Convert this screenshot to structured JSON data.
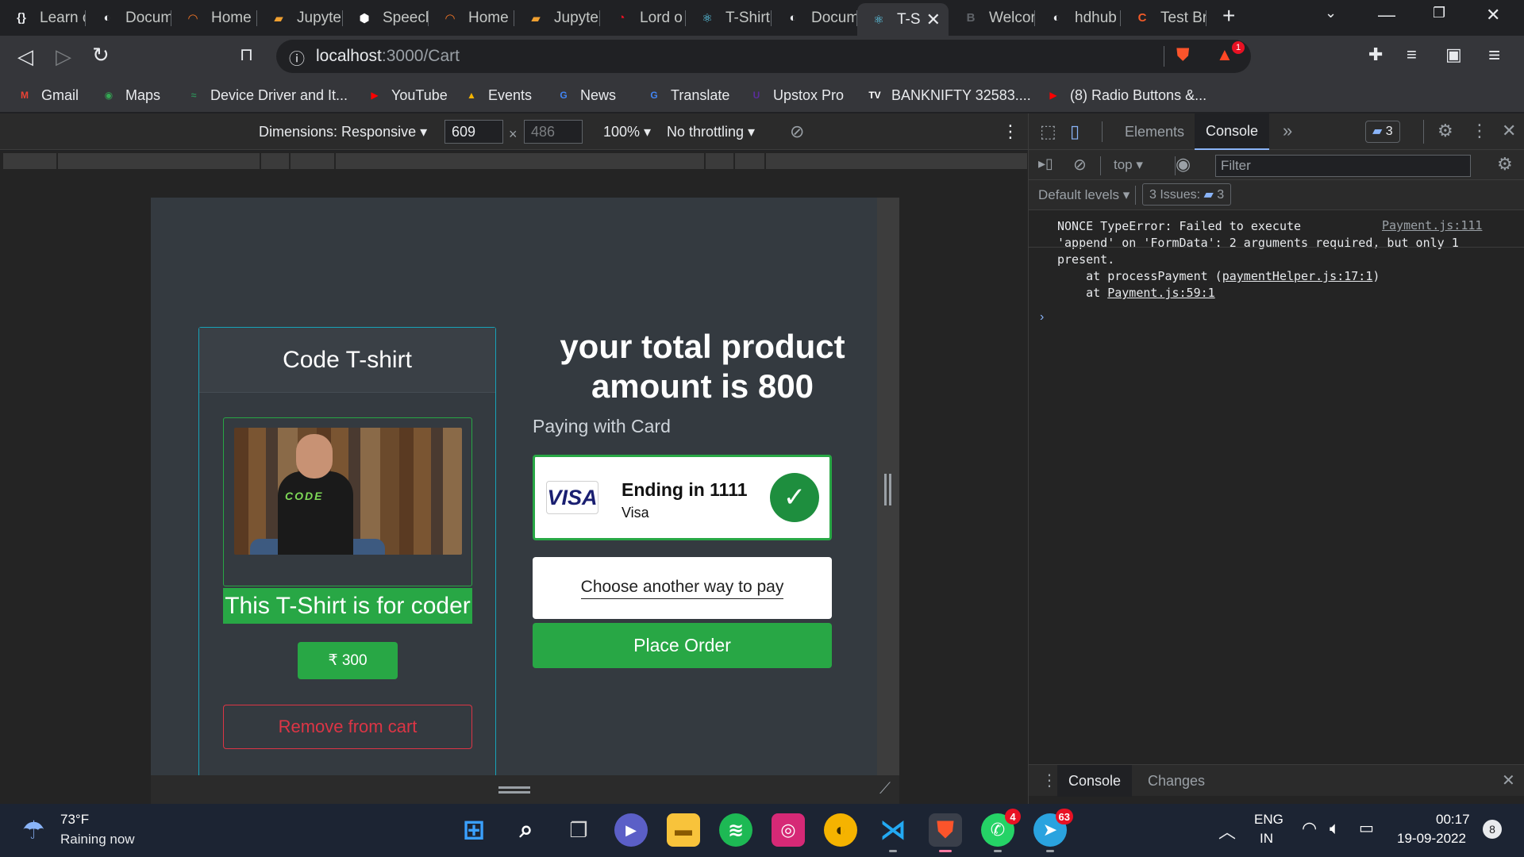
{
  "tabs": [
    {
      "title": "Learn c",
      "icon": "{}",
      "color": "#e8eaed"
    },
    {
      "title": "Docum",
      "icon": "◐",
      "color": "#e8eaed"
    },
    {
      "title": "Home",
      "icon": "◠",
      "color": "#f37626"
    },
    {
      "title": "Jupyte",
      "icon": "▰",
      "color": "#f0a030"
    },
    {
      "title": "Speech",
      "icon": "⬢",
      "color": "#ffffff"
    },
    {
      "title": "Home",
      "icon": "◠",
      "color": "#f37626"
    },
    {
      "title": "Jupyte",
      "icon": "▰",
      "color": "#f0a030"
    },
    {
      "title": "Lord o",
      "icon": "◔",
      "color": "#e81123"
    },
    {
      "title": "T-Shirt",
      "icon": "⚛",
      "color": "#61dafb"
    },
    {
      "title": "Docum",
      "icon": "◐",
      "color": "#e8eaed"
    },
    {
      "title": "T-S",
      "icon": "⚛",
      "color": "#61dafb"
    },
    {
      "title": "Welcor",
      "icon": "B",
      "color": "#5f6368"
    },
    {
      "title": "hdhub",
      "icon": "◐",
      "color": "#e8eaed"
    },
    {
      "title": "Test Br",
      "icon": "C",
      "color": "#f05a28"
    }
  ],
  "address": {
    "host": "localhost",
    "path": ":3000/Cart"
  },
  "brave_badge": "1",
  "bookmarks": [
    {
      "label": "Gmail",
      "icon": "M",
      "color": "#ea4335"
    },
    {
      "label": "Maps",
      "icon": "◉",
      "color": "#34a853"
    },
    {
      "label": "Device Driver and It...",
      "icon": "≈",
      "color": "#2e8b57"
    },
    {
      "label": "YouTube",
      "icon": "▶",
      "color": "#ff0000"
    },
    {
      "label": "Events",
      "icon": "▲",
      "color": "#f4b400"
    },
    {
      "label": "News",
      "icon": "G",
      "color": "#4285f4"
    },
    {
      "label": "Translate",
      "icon": "G",
      "color": "#4285f4"
    },
    {
      "label": "Upstox Pro",
      "icon": "U",
      "color": "#5a2d9c"
    },
    {
      "label": "BANKNIFTY 32583....",
      "icon": "TV",
      "color": "#ffffff"
    },
    {
      "label": "(8) Radio Buttons &...",
      "icon": "▶",
      "color": "#ff0000"
    }
  ],
  "device_toolbar": {
    "dimensions_label": "Dimensions: Responsive ▾",
    "width": "609",
    "height": "486",
    "times": "×",
    "zoom": "100% ▾",
    "throttling": "No throttling ▾"
  },
  "product": {
    "title": "Code T-shirt",
    "description": "This T-Shirt is for coder",
    "price": "₹ 300",
    "remove_label": "Remove from cart",
    "image_logo": "CODE"
  },
  "payment": {
    "total_line1": "your total product",
    "total_line2": "amount is 800",
    "paying_with": "Paying with Card",
    "card_brand_logo": "VISA",
    "card_ending": "Ending in 1111",
    "card_brand": "Visa",
    "other_way": "Choose another way to pay",
    "place_order": "Place Order"
  },
  "devtools": {
    "tabs": [
      "Elements",
      "Console"
    ],
    "issues_count": "3",
    "context": "top ▾",
    "filter_placeholder": "Filter",
    "levels": "Default levels ▾",
    "issues_label": "3 Issues:",
    "issues_badge": "3",
    "console_lines": [
      "NONCE TypeError: Failed to execute",
      "'append' on 'FormData': 2 arguments required, but only 1",
      "present."
    ],
    "stack1_pre": "    at processPayment (",
    "stack1_link": "paymentHelper.js:17:1",
    "stack1_post": ")",
    "stack2_pre": "    at ",
    "stack2_link": "Payment.js:59:1",
    "source": "Payment.js:111",
    "prompt": "›",
    "drawer_tabs": [
      "Console",
      "Changes"
    ]
  },
  "taskbar": {
    "weather_temp": "73°F",
    "weather_text": "Raining now",
    "lang1": "ENG",
    "lang2": "IN",
    "time": "00:17",
    "date": "19-09-2022",
    "notif_count": "8",
    "whatsapp_badge": "4",
    "telegram_badge": "63"
  }
}
